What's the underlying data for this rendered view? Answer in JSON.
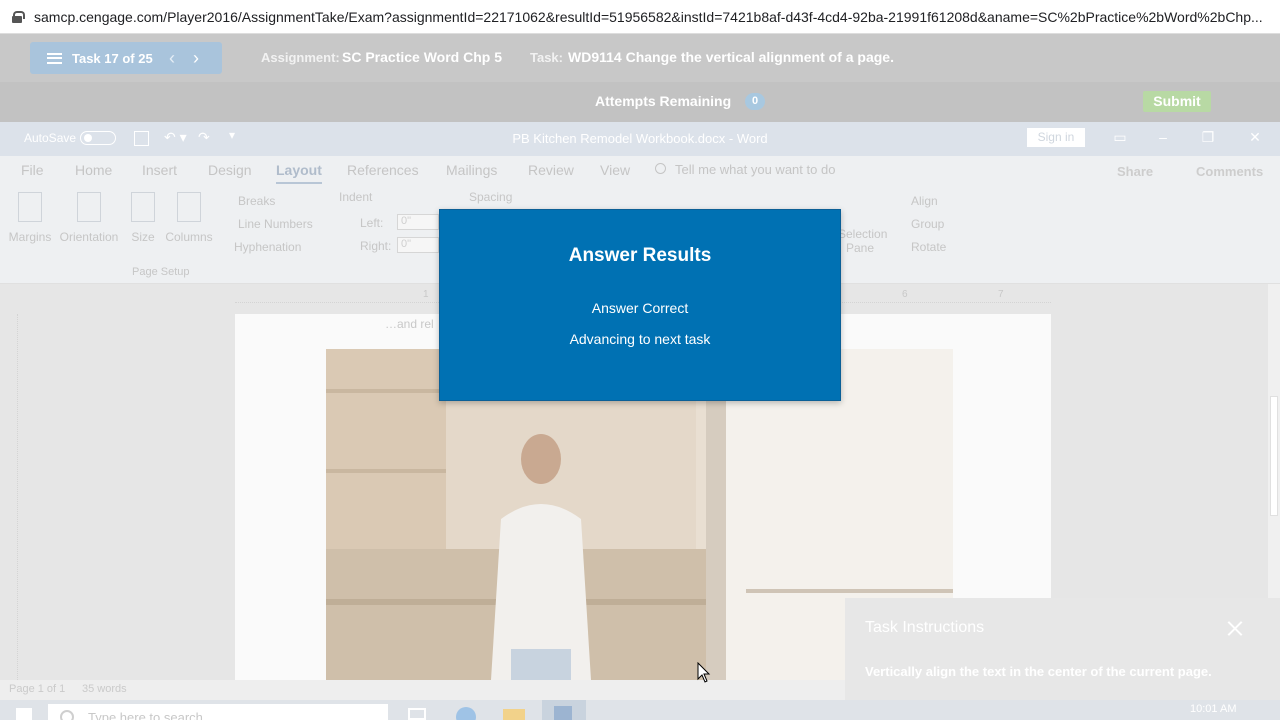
{
  "browser": {
    "url": "samcp.cengage.com/Player2016/AssignmentTake/Exam?assignmentId=22171062&resultId=51956582&instId=7421b8af-d43f-4cd4-92ba-21991f61208d&aname=SC%2bPractice%2bWord%2bChp..."
  },
  "assignment_header": {
    "task_counter": "Task 17 of 25",
    "prev_label": "‹",
    "next_label": "›",
    "assignment_label": "Assignment:",
    "assignment_value": "SC Practice Word Chp 5",
    "task_label": "Task:",
    "task_value": "WD9114 Change the vertical alignment of a page.",
    "attempts_label": "Attempts Remaining",
    "attempts_count": "0",
    "submit_label": "Submit"
  },
  "word": {
    "autosave_label": "AutoSave",
    "doc_title": "PB Kitchen Remodel Workbook.docx - Word",
    "sign_in_label": "Sign in",
    "tabs": [
      "File",
      "Home",
      "Insert",
      "Design",
      "Layout",
      "References",
      "Mailings",
      "Review",
      "View"
    ],
    "active_tab": "Layout",
    "tell_me_placeholder": "Tell me what you want to do",
    "share_label": "Share",
    "comments_label": "Comments",
    "ribbon": {
      "margins": "Margins",
      "orientation": "Orientation",
      "size": "Size",
      "columns": "Columns",
      "breaks": "Breaks",
      "line_numbers": "Line Numbers",
      "hyphenation": "Hyphenation",
      "page_setup_group": "Page Setup",
      "indent_label": "Indent",
      "spacing_label": "Spacing",
      "left_label": "Left:",
      "right_label": "Right:",
      "left_value": "0\"",
      "right_value": "0\"",
      "selection_pane_1": "Selection",
      "selection_pane_2": "Pane",
      "align": "Align",
      "group": "Group",
      "rotate": "Rotate"
    },
    "ruler_numbers": [
      "1",
      "6",
      "7"
    ],
    "page_text": "…and rel",
    "status": {
      "page": "Page 1 of 1",
      "words": "35 words"
    }
  },
  "modal": {
    "title": "Answer Results",
    "line1": "Answer Correct",
    "line2": "Advancing to next task"
  },
  "task_instructions": {
    "title": "Task Instructions",
    "text": "Vertically align the text in the center of the current page."
  },
  "taskbar": {
    "search_placeholder": "Type here to search",
    "time": "10:01 AM"
  }
}
